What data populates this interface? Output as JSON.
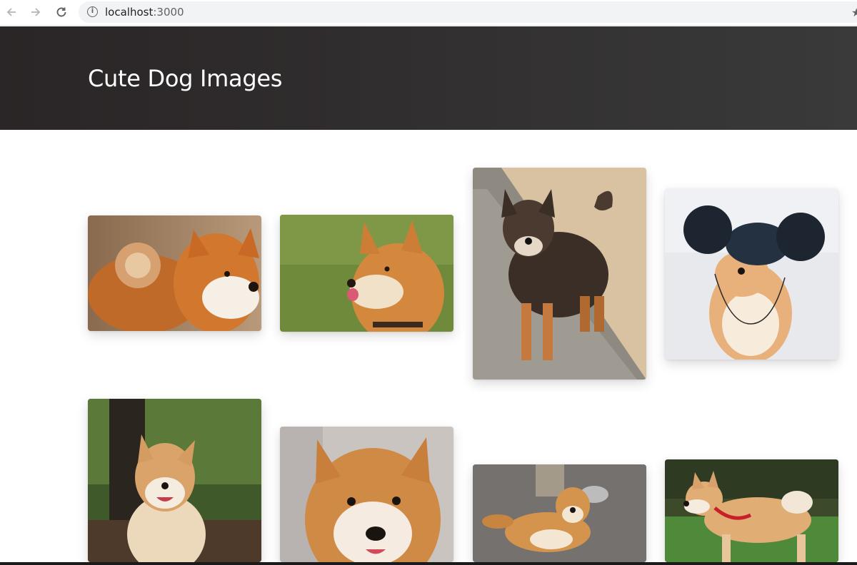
{
  "browser": {
    "url_host": "localhost",
    "url_port": ":3000",
    "icons": [
      "back-arrow-icon",
      "forward-arrow-icon",
      "reload-icon",
      "info-icon",
      "star-icon"
    ]
  },
  "header": {
    "title": "Cute Dog Images"
  },
  "gallery": {
    "cards": [
      {
        "subject": "shiba-inu-closeup-curled-tail"
      },
      {
        "subject": "shiba-inu-licking-nose-on-grass"
      },
      {
        "subject": "dark-shiba-standing-on-wall"
      },
      {
        "subject": "shiba-wearing-mouse-ear-hat"
      },
      {
        "subject": "shiba-smiling-in-forest"
      },
      {
        "subject": "shiba-face-closeup"
      },
      {
        "subject": "shiba-lying-on-gravel"
      },
      {
        "subject": "shiba-walking-on-grass-red-harness"
      }
    ]
  },
  "colors": {
    "header_bg": "#2d2a2b",
    "header_text": "#ffffff",
    "page_bg": "#ffffff"
  }
}
